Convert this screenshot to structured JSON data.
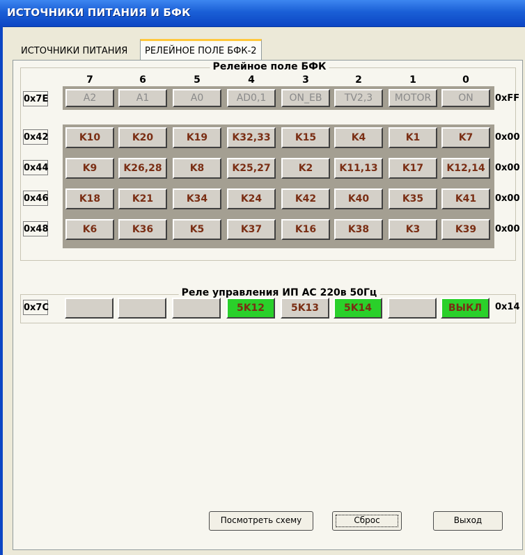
{
  "window": {
    "title": "ИСТОЧНИКИ ПИТАНИЯ И БФК"
  },
  "tabs": [
    {
      "label": "ИСТОЧНИКИ ПИТАНИЯ",
      "active": false
    },
    {
      "label": "РЕЛЕЙНОЕ ПОЛЕ БФК-2",
      "active": true
    }
  ],
  "relay_field": {
    "title": "Релейное поле БФК",
    "columns": [
      "7",
      "6",
      "5",
      "4",
      "3",
      "2",
      "1",
      "0"
    ],
    "control_row": {
      "address": "0x7E",
      "value": "0xFF",
      "labels": [
        "A2",
        "A1",
        "A0",
        "AD0,1",
        "ON_EB",
        "TV2,3",
        "MOTOR",
        "ON"
      ]
    },
    "rows": [
      {
        "address": "0x42",
        "value": "0x00",
        "labels": [
          "K10",
          "K20",
          "K19",
          "K32,33",
          "K15",
          "K4",
          "K1",
          "K7"
        ]
      },
      {
        "address": "0x44",
        "value": "0x00",
        "labels": [
          "K9",
          "K26,28",
          "K8",
          "K25,27",
          "K2",
          "K11,13",
          "K17",
          "K12,14"
        ]
      },
      {
        "address": "0x46",
        "value": "0x00",
        "labels": [
          "K18",
          "K21",
          "K34",
          "K24",
          "K42",
          "K40",
          "K35",
          "K41"
        ]
      },
      {
        "address": "0x48",
        "value": "0x00",
        "labels": [
          "K6",
          "K36",
          "K5",
          "K37",
          "K16",
          "K38",
          "K3",
          "K39"
        ]
      }
    ]
  },
  "power_relays": {
    "title": "Реле управления ИП АС 220в 50Гц",
    "address": "0x7C",
    "value": "0x14",
    "buttons": [
      {
        "label": "",
        "state": "blank"
      },
      {
        "label": "",
        "state": "blank"
      },
      {
        "label": "",
        "state": "blank"
      },
      {
        "label": "5K12",
        "state": "on"
      },
      {
        "label": "5K13",
        "state": "off"
      },
      {
        "label": "5K14",
        "state": "on"
      },
      {
        "label": "",
        "state": "blank"
      },
      {
        "label": "ВЫКЛ",
        "state": "on"
      }
    ]
  },
  "footer": {
    "view_scheme": "Посмотреть схему",
    "reset": "Сброс",
    "exit": "Выход"
  },
  "colors": {
    "relay_on": "#2ad02a",
    "relay_text": "#7a2e14",
    "title_bar": "#0c46c4"
  }
}
